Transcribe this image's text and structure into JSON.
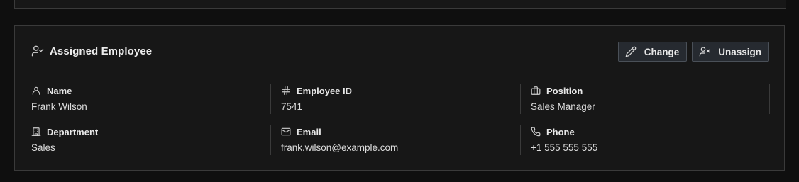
{
  "card": {
    "title": "Assigned Employee",
    "title_icon": "user-check-icon",
    "actions": {
      "change_label": "Change",
      "change_icon": "pencil-icon",
      "unassign_label": "Unassign",
      "unassign_icon": "user-x-icon"
    },
    "fields": [
      {
        "label": "Name",
        "value": "Frank Wilson",
        "icon": "user-icon"
      },
      {
        "label": "Employee ID",
        "value": "7541",
        "icon": "hash-icon"
      },
      {
        "label": "Position",
        "value": "Sales Manager",
        "icon": "briefcase-icon"
      },
      {
        "label": "Department",
        "value": "Sales",
        "icon": "building-icon"
      },
      {
        "label": "Email",
        "value": "frank.wilson@example.com",
        "icon": "mail-icon"
      },
      {
        "label": "Phone",
        "value": "+1 555 555 555",
        "icon": "phone-icon"
      }
    ]
  }
}
